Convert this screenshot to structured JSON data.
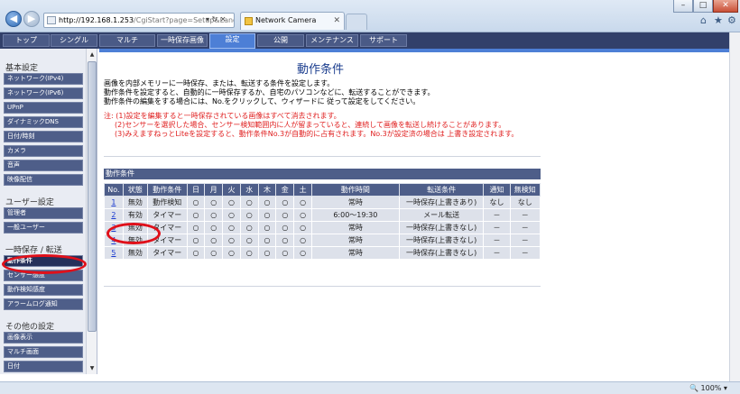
{
  "browser": {
    "address_host": "http://192.168.1.253",
    "address_rest": "/CgiStart?page=Setup&Language=1",
    "address_controls": "▾ ↻ ✕",
    "tab_title": "Network Camera",
    "zoom": "100%"
  },
  "topnav": {
    "items": [
      "トップ",
      "シングル",
      "マルチ",
      "一時保存画像",
      "設定",
      "公開",
      "メンテナンス",
      "サポート"
    ],
    "active": "設定"
  },
  "sidebar": {
    "groups": [
      {
        "heading": "基本設定",
        "items": [
          "ネットワーク(IPv4)",
          "ネットワーク(IPv6)",
          "UPnP",
          "ダイナミックDNS",
          "日付/時刻",
          "カメラ",
          "音声",
          "映像配信"
        ]
      },
      {
        "heading": "ユーザー設定",
        "items": [
          "管理者",
          "一般ユーザー"
        ]
      },
      {
        "heading": "一時保存 / 転送",
        "items": [
          "動作条件",
          "センサー感度",
          "動作検知感度",
          "アラームログ通知"
        ]
      },
      {
        "heading": "その他の設定",
        "items": [
          "画像表示",
          "マルチ画面",
          "日付"
        ]
      }
    ],
    "current": "動作条件"
  },
  "main": {
    "title": "動作条件",
    "intro": [
      "画像を内部メモリーに一時保存、または、転送する条件を設定します。",
      "動作条件を設定すると、自動的に一時保存するか、自宅のパソコンなどに、転送することができます。",
      "動作条件の編集をする場合には、No.をクリックして、ウィザードに 従って設定をしてください。"
    ],
    "notes": [
      "注: (1)設定を編集すると一時保存されている画像はすべて消去されます。",
      "(2)センサーを選択した場合、センサー検知範囲内に人が留まっていると、連続して画像を転送し続けることがあります。",
      "(3)みえますねっとLiteを設定すると、動作条件No.3が自動的に占有されます。No.3が設定済の場合は 上書き設定されます。"
    ],
    "table_title": "動作条件",
    "columns": [
      "No.",
      "状態",
      "動作条件",
      "日",
      "月",
      "火",
      "水",
      "木",
      "金",
      "土",
      "動作時間",
      "転送条件",
      "通知",
      "無検知"
    ],
    "rows": [
      [
        "1",
        "無効",
        "動作検知",
        "○",
        "○",
        "○",
        "○",
        "○",
        "○",
        "○",
        "常時",
        "一時保存(上書きあり)",
        "なし",
        "なし"
      ],
      [
        "2",
        "有効",
        "タイマー",
        "○",
        "○",
        "○",
        "○",
        "○",
        "○",
        "○",
        "6:00～19:30",
        "メール転送",
        "－",
        "－"
      ],
      [
        "3",
        "無効",
        "タイマー",
        "○",
        "○",
        "○",
        "○",
        "○",
        "○",
        "○",
        "常時",
        "一時保存(上書きなし)",
        "－",
        "－"
      ],
      [
        "4",
        "無効",
        "タイマー",
        "○",
        "○",
        "○",
        "○",
        "○",
        "○",
        "○",
        "常時",
        "一時保存(上書きなし)",
        "－",
        "－"
      ],
      [
        "5",
        "無効",
        "タイマー",
        "○",
        "○",
        "○",
        "○",
        "○",
        "○",
        "○",
        "常時",
        "一時保存(上書きなし)",
        "－",
        "－"
      ]
    ]
  },
  "colors": {
    "nav_bg": "#32406a",
    "nav_active": "#4d7fd6",
    "sidebar_item": "#4e5e89",
    "note_red": "#e02020",
    "highlight_oval": "#e0101a"
  }
}
